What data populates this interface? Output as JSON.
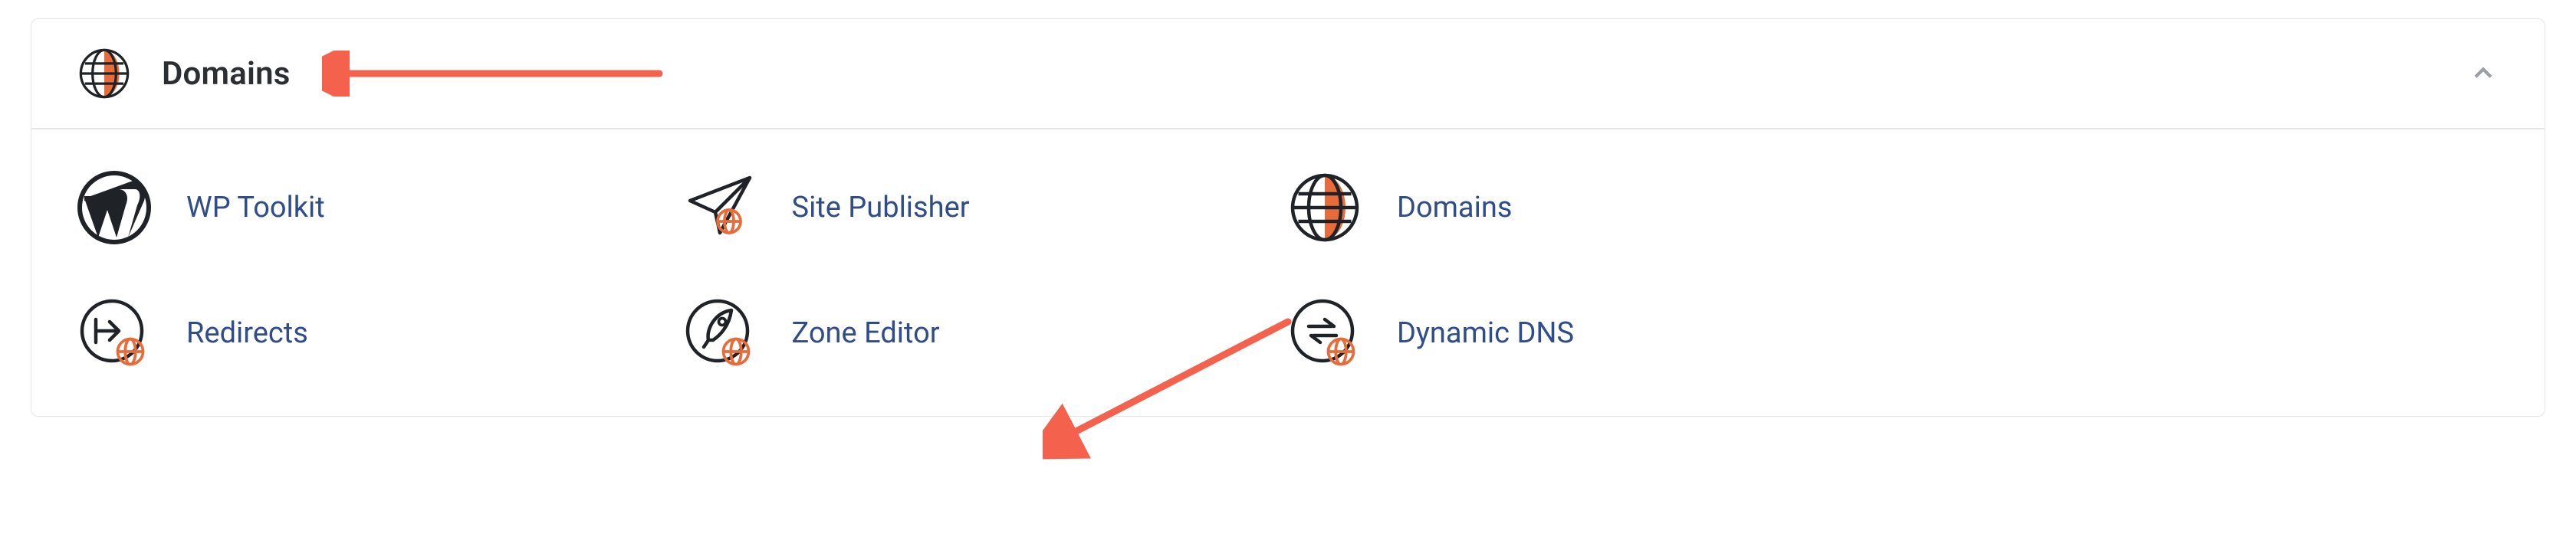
{
  "panel": {
    "title": "Domains",
    "collapsed": false
  },
  "tiles": {
    "wp_toolkit": {
      "label": "WP Toolkit"
    },
    "site_publisher": {
      "label": "Site Publisher"
    },
    "domains": {
      "label": "Domains"
    },
    "redirects": {
      "label": "Redirects"
    },
    "zone_editor": {
      "label": "Zone Editor"
    },
    "dynamic_dns": {
      "label": "Dynamic DNS"
    }
  },
  "annotations": {
    "arrow_to_header": true,
    "arrow_to_zone_editor": true
  },
  "colors": {
    "accent": "#e86c3a",
    "link": "#2f4d8a",
    "text": "#2b2f33",
    "border": "#e4e6ea",
    "arrow": "#f4614d"
  }
}
